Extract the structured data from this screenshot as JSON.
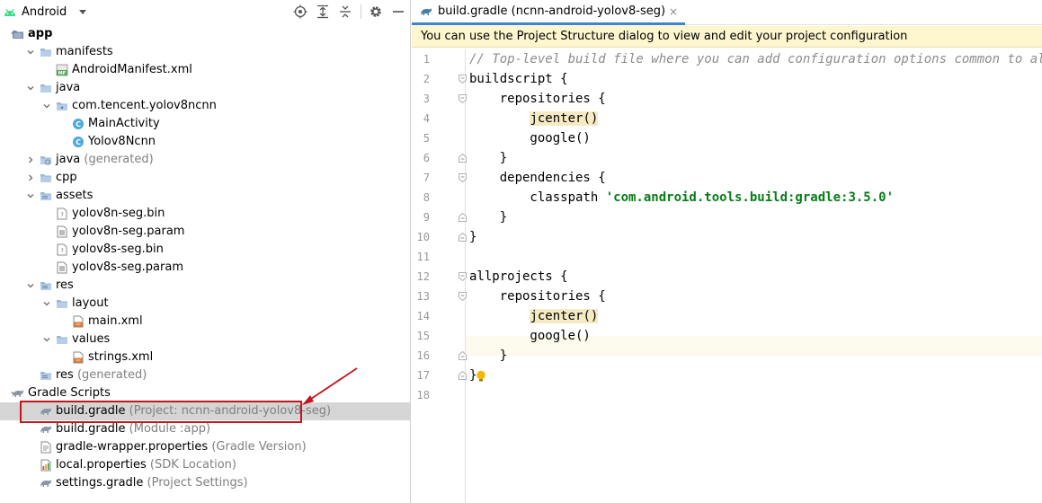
{
  "project_panel": {
    "view_selector": "Android",
    "header_buttons": [
      "locate-icon",
      "expand-all-icon",
      "collapse-all-icon",
      "gear-icon",
      "hide-icon"
    ],
    "tree": [
      {
        "label": "app",
        "hint": "",
        "icon": "module-folder-icon",
        "expanded": true,
        "bold": true
      },
      {
        "label": "manifests",
        "hint": "",
        "icon": "folder-icon",
        "expanded": true
      },
      {
        "label": "AndroidManifest.xml",
        "hint": "",
        "icon": "manifest-file-icon"
      },
      {
        "label": "java",
        "hint": "",
        "icon": "folder-icon",
        "expanded": true
      },
      {
        "label": "com.tencent.yolov8ncnn",
        "hint": "",
        "icon": "package-icon",
        "expanded": true
      },
      {
        "label": "MainActivity",
        "hint": "",
        "icon": "class-icon"
      },
      {
        "label": "Yolov8Ncnn",
        "hint": "",
        "icon": "class-icon"
      },
      {
        "label": "java",
        "hint": "(generated)",
        "icon": "generated-folder-icon",
        "expanded": false
      },
      {
        "label": "cpp",
        "hint": "",
        "icon": "folder-icon",
        "expanded": false
      },
      {
        "label": "assets",
        "hint": "",
        "icon": "assets-folder-icon",
        "expanded": true
      },
      {
        "label": "yolov8n-seg.bin",
        "hint": "",
        "icon": "binary-file-icon"
      },
      {
        "label": "yolov8n-seg.param",
        "hint": "",
        "icon": "text-file-icon"
      },
      {
        "label": "yolov8s-seg.bin",
        "hint": "",
        "icon": "binary-file-icon"
      },
      {
        "label": "yolov8s-seg.param",
        "hint": "",
        "icon": "text-file-icon"
      },
      {
        "label": "res",
        "hint": "",
        "icon": "res-folder-icon",
        "expanded": true
      },
      {
        "label": "layout",
        "hint": "",
        "icon": "folder-icon",
        "expanded": true
      },
      {
        "label": "main.xml",
        "hint": "",
        "icon": "xml-file-icon"
      },
      {
        "label": "values",
        "hint": "",
        "icon": "folder-icon",
        "expanded": true
      },
      {
        "label": "strings.xml",
        "hint": "",
        "icon": "xml-file-icon"
      },
      {
        "label": "res",
        "hint": "(generated)",
        "icon": "res-folder-icon"
      },
      {
        "label": "Gradle Scripts",
        "hint": "",
        "icon": "gradle-icon",
        "expanded": true
      },
      {
        "label": "build.gradle",
        "hint": "(Project: ncnn-android-yolov8-seg)",
        "icon": "gradle-icon",
        "selected": true
      },
      {
        "label": "build.gradle",
        "hint": "(Module :app)",
        "icon": "gradle-icon"
      },
      {
        "label": "gradle-wrapper.properties",
        "hint": "(Gradle Version)",
        "icon": "properties-file-icon"
      },
      {
        "label": "local.properties",
        "hint": "(SDK Location)",
        "icon": "properties-chart-icon"
      },
      {
        "label": "settings.gradle",
        "hint": "(Project Settings)",
        "icon": "gradle-icon"
      }
    ]
  },
  "editor": {
    "tab": {
      "label": "build.gradle (ncnn-android-yolov8-seg)",
      "close": "×"
    },
    "banner": "You can use the Project Structure dialog to view and edit your project configuration",
    "lines": [
      {
        "n": "1",
        "tokens": [
          {
            "t": "// Top-level build file where you can add configuration options common to all sub-projects/modules.",
            "c": "cmt"
          }
        ]
      },
      {
        "n": "2",
        "tokens": [
          {
            "t": "buildscript {"
          }
        ]
      },
      {
        "n": "3",
        "tokens": [
          {
            "t": "    repositories {"
          }
        ]
      },
      {
        "n": "4",
        "tokens": [
          {
            "t": "        "
          },
          {
            "t": "jcenter()",
            "c": "hl"
          }
        ]
      },
      {
        "n": "5",
        "tokens": [
          {
            "t": "        google()"
          }
        ]
      },
      {
        "n": "6",
        "tokens": [
          {
            "t": "    }"
          }
        ]
      },
      {
        "n": "7",
        "tokens": [
          {
            "t": "    dependencies {"
          }
        ]
      },
      {
        "n": "8",
        "tokens": [
          {
            "t": "        classpath "
          },
          {
            "t": "'com.android.tools.build:gradle:3.5.0'",
            "c": "str"
          }
        ]
      },
      {
        "n": "9",
        "tokens": [
          {
            "t": "    }"
          }
        ]
      },
      {
        "n": "10",
        "tokens": [
          {
            "t": "}"
          }
        ]
      },
      {
        "n": "11",
        "tokens": [
          {
            "t": ""
          }
        ]
      },
      {
        "n": "12",
        "tokens": [
          {
            "t": "allprojects {"
          }
        ]
      },
      {
        "n": "13",
        "tokens": [
          {
            "t": "    repositories {"
          }
        ]
      },
      {
        "n": "14",
        "tokens": [
          {
            "t": "        "
          },
          {
            "t": "jcenter()",
            "c": "hl"
          }
        ]
      },
      {
        "n": "15",
        "tokens": [
          {
            "t": "        google()"
          }
        ]
      },
      {
        "n": "16",
        "tokens": [
          {
            "t": "    }"
          }
        ]
      },
      {
        "n": "17",
        "tokens": [
          {
            "t": "}"
          }
        ]
      },
      {
        "n": "18",
        "tokens": [
          {
            "t": ""
          }
        ]
      }
    ]
  },
  "colors": {
    "selection": "#d5d5d5",
    "annotation": "#c4161c",
    "banner": "#fdf6cf",
    "tab_underline": "#4083c9"
  }
}
